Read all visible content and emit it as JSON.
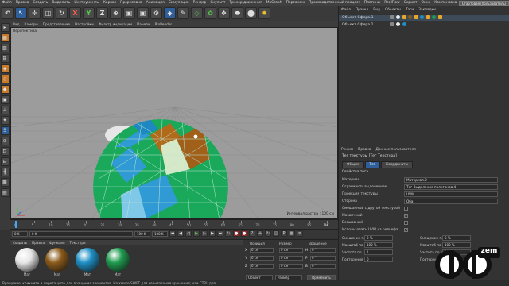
{
  "menubar": {
    "items": [
      "Файл",
      "Правка",
      "Создать",
      "Выделить",
      "Инструменты",
      "Каркас",
      "Прорисовка",
      "Анимация",
      "Симуляция",
      "Рендер",
      "Скульпт",
      "Трекер движения",
      "MoGraph",
      "Персонаж",
      "Производственный процесс",
      "Плагины",
      "RealFlow",
      "Скрипт",
      "Окно",
      "Компоновка"
    ],
    "layout": "Стартовая (пользователь)"
  },
  "toolbar": {
    "buttons": [
      {
        "name": "undo-icon",
        "glyph": "↶",
        "style": ""
      },
      {
        "name": "live-select-icon",
        "glyph": "↖",
        "style": "blue"
      },
      {
        "name": "move-icon",
        "glyph": "✛",
        "style": ""
      },
      {
        "name": "scale-icon",
        "glyph": "◫",
        "style": ""
      },
      {
        "name": "rotate-icon",
        "glyph": "↻",
        "style": ""
      },
      {
        "name": "x-axis-button",
        "glyph": "X",
        "style": "red"
      },
      {
        "name": "y-axis-button",
        "glyph": "Y",
        "style": "green"
      },
      {
        "name": "z-axis-button",
        "glyph": "Z",
        "style": ""
      },
      {
        "name": "coord-system-icon",
        "glyph": "⊕",
        "style": ""
      },
      {
        "name": "render-view-icon",
        "glyph": "▣",
        "style": ""
      },
      {
        "name": "render-picture-icon",
        "glyph": "▣",
        "style": ""
      },
      {
        "name": "render-settings-icon",
        "glyph": "⚙",
        "style": ""
      },
      {
        "name": "cube-icon",
        "glyph": "◆",
        "style": "blue"
      },
      {
        "name": "pen-icon",
        "glyph": "✎",
        "style": ""
      },
      {
        "name": "subdivision-icon",
        "glyph": "◇",
        "style": "green"
      },
      {
        "name": "array-icon",
        "glyph": "✿",
        "style": "green"
      },
      {
        "name": "deformer-icon",
        "glyph": "❖",
        "style": ""
      },
      {
        "name": "environment-icon",
        "glyph": "⬬",
        "style": ""
      },
      {
        "name": "camera-icon",
        "glyph": "⬤",
        "style": ""
      },
      {
        "name": "light-icon",
        "glyph": "✹",
        "style": "yel"
      }
    ]
  },
  "lefttoolbar": {
    "buttons": [
      {
        "name": "make-editable-icon",
        "glyph": "▸",
        "style": ""
      },
      {
        "name": "model-mode-icon",
        "glyph": "▦",
        "style": "or"
      },
      {
        "name": "texture-mode-icon",
        "glyph": "▧",
        "style": ""
      },
      {
        "name": "workplane-icon",
        "glyph": "⊞",
        "style": ""
      },
      {
        "name": "points-mode-icon",
        "glyph": "◈",
        "style": "or"
      },
      {
        "name": "edges-mode-icon",
        "glyph": "◇",
        "style": "or"
      },
      {
        "name": "polygons-mode-icon",
        "glyph": "◆",
        "style": "or"
      },
      {
        "name": "uvw-mode-icon",
        "glyph": "▣",
        "style": ""
      },
      {
        "name": "axis-mode-icon",
        "glyph": "⊥",
        "style": ""
      },
      {
        "name": "tweak-icon",
        "glyph": "✦",
        "style": ""
      },
      {
        "name": "snap-icon",
        "glyph": "S",
        "style": "bl"
      },
      {
        "name": "snap-settings-icon",
        "glyph": "⊘",
        "style": ""
      },
      {
        "name": "lock-workplane-icon",
        "glyph": "⊡",
        "style": ""
      },
      {
        "name": "planar-workplane-icon",
        "glyph": "⊟",
        "style": ""
      },
      {
        "name": "axis-workplane-icon",
        "glyph": "╋",
        "style": ""
      },
      {
        "name": "solo-icon",
        "glyph": "▩",
        "style": ""
      },
      {
        "name": "viewport-solo-icon",
        "glyph": "▤",
        "style": ""
      }
    ]
  },
  "viewport": {
    "menu": [
      "Вид",
      "Камеры",
      "Представление",
      "Настройки",
      "Фильтр индикации",
      "Панели",
      "ProRender"
    ],
    "label": "Перспектива",
    "status": "Интервал растра : 100 см"
  },
  "timeline": {
    "ticks": [
      "0",
      "5",
      "10",
      "15",
      "20",
      "25",
      "30",
      "35",
      "40",
      "45",
      "50",
      "55",
      "60",
      "65",
      "70",
      "75",
      "80",
      "85",
      "90"
    ],
    "frame": "0 K"
  },
  "transport": {
    "start": "0 K",
    "min": "0 K",
    "end": "100 K",
    "max": "100 K"
  },
  "materials": {
    "menu": [
      "Создать",
      "Правка",
      "Функция",
      "Текстура"
    ],
    "items": [
      {
        "label": "Мат",
        "color": "#e6e6e6"
      },
      {
        "label": "Мат",
        "color": "#8a5a1a"
      },
      {
        "label": "Мат",
        "color": "#1e8fc4"
      },
      {
        "label": "Мат",
        "color": "#1f9a4f"
      }
    ]
  },
  "coordinates": {
    "headers": [
      "Позиция",
      "Размер",
      "Вращение"
    ],
    "rows": [
      {
        "axis": "X",
        "pos": "0 см",
        "size": "0 см",
        "rotl": "H",
        "rot": "0 °"
      },
      {
        "axis": "Y",
        "pos": "0 см",
        "size": "0 см",
        "rotl": "P",
        "rot": "0 °"
      },
      {
        "axis": "Z",
        "pos": "0 см",
        "size": "0 см",
        "rotl": "B",
        "rot": "0 °"
      }
    ],
    "mode1": "Объект",
    "mode2": "Размер",
    "apply": "Применить"
  },
  "objects": {
    "menu": [
      "Файл",
      "Правка",
      "Вид",
      "Объекты",
      "Тэги",
      "Закладки"
    ],
    "rows": [
      {
        "label": "Объект Сфера.1",
        "selected": true
      },
      {
        "label": "Объект Сфера.1",
        "selected": false
      }
    ]
  },
  "attributes": {
    "menu": [
      "Режим",
      "Правка",
      "Данные пользователя"
    ],
    "title": "Тег текстуры [Тег Текстура]",
    "tabs": [
      "Общие",
      "Тег",
      "Координаты"
    ],
    "section": "Свойства тега",
    "rows": [
      {
        "label": "Материал",
        "value": "Материал.2",
        "type": "field"
      },
      {
        "label": "Ограничить выделением...",
        "value": "Тег Выделение полигонов.4",
        "type": "field"
      },
      {
        "label": "Проекция текстуры",
        "value": "UVW",
        "type": "field"
      },
      {
        "label": "Сторона",
        "value": "Оба",
        "type": "field"
      },
      {
        "label": "Смешанный с другой текстурой",
        "value": "",
        "type": "check"
      },
      {
        "label": "Мозаичный",
        "value": "✔",
        "type": "check"
      },
      {
        "label": "Бесшовный",
        "value": "",
        "type": "check"
      },
      {
        "label": "Использовать UVW из рельефа",
        "value": "✔",
        "type": "check"
      }
    ],
    "numeric": [
      {
        "l1": "Смещение по U",
        "v1": "0 %",
        "l2": "Смещение по V",
        "v2": "0 %"
      },
      {
        "l1": "Масштаб по U",
        "v1": "100 %",
        "l2": "Масштаб по V",
        "v2": "100 %"
      },
      {
        "l1": "Частота по U",
        "v1": "1",
        "l2": "Частота по V",
        "v2": "1"
      },
      {
        "l1": "Повторение U",
        "v1": "0",
        "l2": "Повторение V",
        "v2": "0"
      }
    ]
  },
  "statusbar": "Вращение: кликните и перетащите для вращения элементов. Нажмите SHIFT для квантования вращения; или CTRL для...",
  "logo": {
    "text": "zem"
  }
}
